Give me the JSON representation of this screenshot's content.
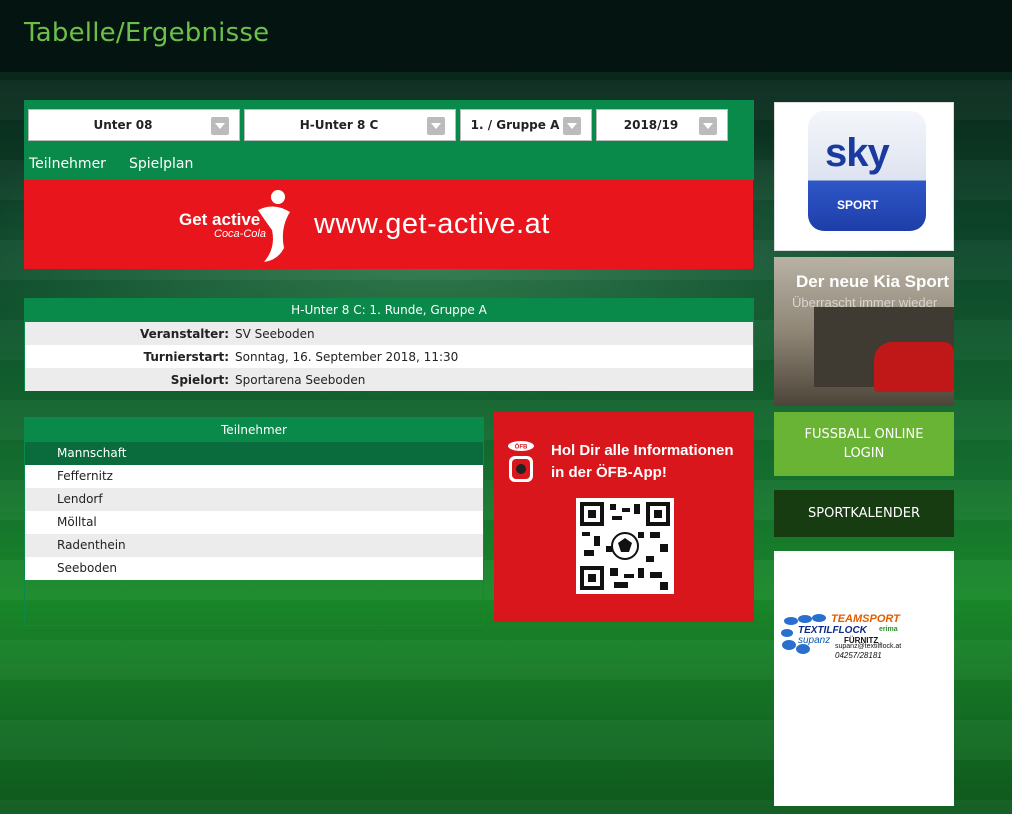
{
  "header": {
    "title": "Tabelle/Ergebnisse"
  },
  "filters": [
    {
      "value": "Unter 08"
    },
    {
      "value": "H-Unter 8 C"
    },
    {
      "value": "1. / Gruppe A"
    },
    {
      "value": "2018/19"
    }
  ],
  "tabs": [
    {
      "label": "Teilnehmer"
    },
    {
      "label": "Spielplan"
    }
  ],
  "ad_getactive": {
    "brand": "Get active",
    "sub": "Coca-Cola",
    "url": "www.get-active.at"
  },
  "tournament": {
    "heading": "H-Unter 8 C: 1. Runde, Gruppe A",
    "rows": [
      {
        "label": "Veranstalter:",
        "value": "SV Seeboden"
      },
      {
        "label": "Turnierstart:",
        "value": "Sonntag, 16. September 2018, 11:30"
      },
      {
        "label": "Spielort:",
        "value": "Sportarena Seeboden"
      }
    ]
  },
  "participants": {
    "heading": "Teilnehmer",
    "column": "Mannschaft",
    "teams": [
      "Feffernitz",
      "Lendorf",
      "Mölltal",
      "Radenthein",
      "Seeboden"
    ]
  },
  "ad_oefb": {
    "line1": "Hol Dir alle Informationen",
    "line2": "in der ÖFB-App!",
    "logo_text": "ÖFB"
  },
  "ad_sky": {
    "logo": "sky",
    "sub": "SPORT"
  },
  "ad_kia": {
    "title": "Der neue Kia Sport",
    "sub": "Überrascht immer wieder"
  },
  "sidebar": {
    "login_line1": "FUSSBALL ONLINE",
    "login_line2": "LOGIN",
    "kalender": "SPORTKALENDER"
  },
  "ad_teamsport": {
    "title": "TEAMSPORT",
    "flock": "TEXTILFLOCK",
    "erima": "erima",
    "supanz": "supanz",
    "fuernitz": "FÜRNITZ",
    "email": "supanz@textilflock.at",
    "phone": "04257/28181"
  },
  "colors": {
    "primary": "#0a8a4a",
    "accent": "#6cc04a",
    "red": "#e8161c",
    "login": "#69b434",
    "kalender": "#173c12"
  }
}
